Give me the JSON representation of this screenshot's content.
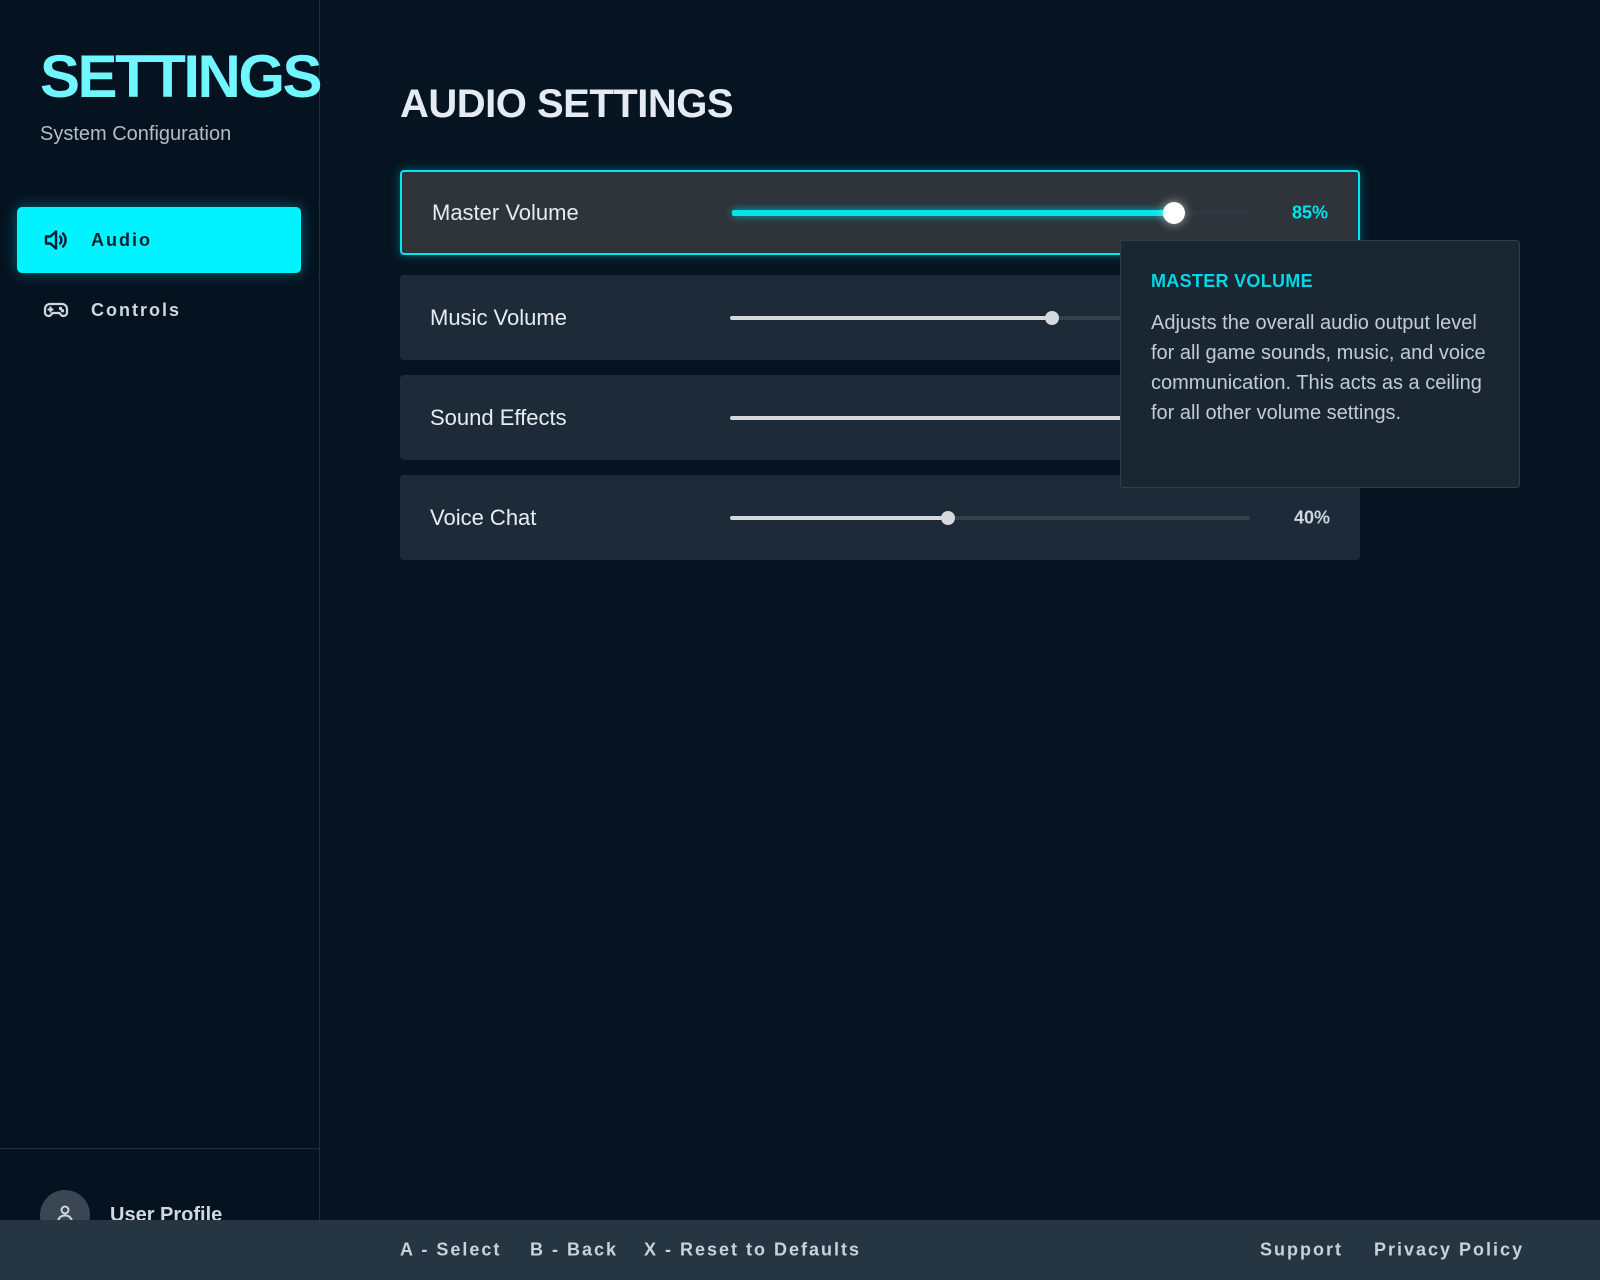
{
  "sidebar": {
    "title": "SETTINGS",
    "subtitle": "System Configuration",
    "nav": [
      {
        "label": "Audio",
        "icon": "speaker-icon",
        "active": true
      },
      {
        "label": "Controls",
        "icon": "gamepad-icon",
        "active": false
      }
    ],
    "profile": {
      "name": "User Profile",
      "icon": "user-icon"
    }
  },
  "main": {
    "title": "AUDIO SETTINGS",
    "settings": [
      {
        "label": "Master Volume",
        "value": 85,
        "value_text": "85%"
      },
      {
        "label": "Music Volume",
        "value": 62
      },
      {
        "label": "Sound Effects",
        "value": 80
      },
      {
        "label": "Voice Chat",
        "value": 42,
        "value_text": "40%"
      }
    ]
  },
  "tooltip": {
    "title": "MASTER VOLUME",
    "body": "Adjusts the overall audio output level for all game sounds, music, and voice communication. This acts as a ceiling for all other volume settings."
  },
  "footer": {
    "hints": [
      "A - Select",
      "B - Back",
      "X - Reset to Defaults"
    ],
    "links": [
      "Support",
      "Privacy Policy"
    ]
  },
  "colors": {
    "accent": "#00f3ff",
    "background": "#061422",
    "row": "#1d2b38",
    "footer": "#263542"
  }
}
